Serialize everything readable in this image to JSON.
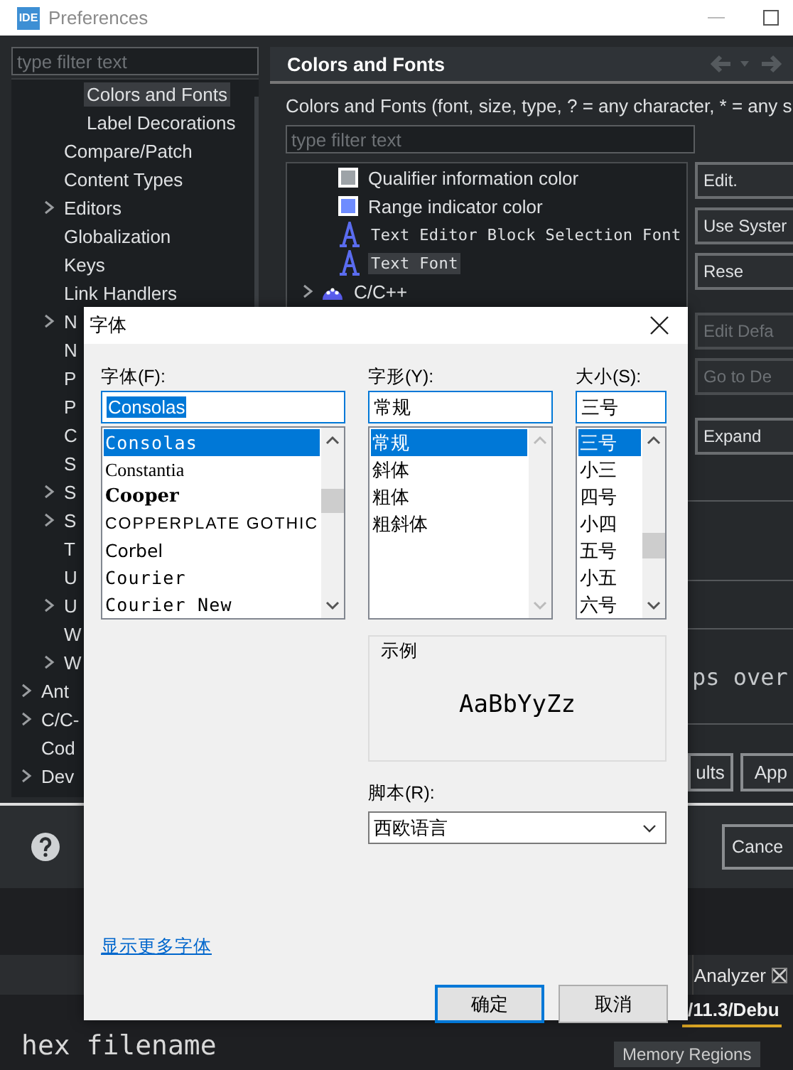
{
  "window": {
    "logo": "IDE",
    "title": "Preferences"
  },
  "sidebar": {
    "filter_placeholder": "type filter text",
    "items": [
      {
        "children": [
          {
            "children": [
              {
                "label": "Colors and Fonts",
                "has_children": false,
                "selected": true
              },
              {
                "label": "Label Decorations",
                "has_children": false,
                "selected": false
              }
            ]
          },
          {
            "label": "Compare/Patch",
            "has_children": false,
            "selected": false
          },
          {
            "label": "Content Types",
            "has_children": false,
            "selected": false
          },
          {
            "label": "Editors",
            "has_children": true,
            "selected": false
          },
          {
            "label": "Globalization",
            "has_children": false,
            "selected": false
          },
          {
            "label": "Keys",
            "has_children": false,
            "selected": false
          },
          {
            "label": "Link Handlers",
            "has_children": false,
            "selected": false
          },
          {
            "label": "N",
            "has_children": true,
            "selected": false
          },
          {
            "label": "N",
            "has_children": false,
            "selected": false
          },
          {
            "label": "P",
            "has_children": false,
            "selected": false
          },
          {
            "label": "P",
            "has_children": false,
            "selected": false
          },
          {
            "label": "C",
            "has_children": false,
            "selected": false
          },
          {
            "label": "S",
            "has_children": false,
            "selected": false
          },
          {
            "label": "S",
            "has_children": true,
            "selected": false
          },
          {
            "label": "S",
            "has_children": true,
            "selected": false
          },
          {
            "label": "T",
            "has_children": false,
            "selected": false
          },
          {
            "label": "U",
            "has_children": false,
            "selected": false
          },
          {
            "label": "U",
            "has_children": true,
            "selected": false
          },
          {
            "label": "W",
            "has_children": false,
            "selected": false
          },
          {
            "label": "W",
            "has_children": true,
            "selected": false
          }
        ]
      },
      {
        "label": "Ant",
        "has_children": true,
        "selected": false
      },
      {
        "label": "C/C-",
        "has_children": true,
        "selected": false
      },
      {
        "label": "Cod",
        "has_children": false,
        "selected": false
      },
      {
        "label": "Dev",
        "has_children": true,
        "selected": false
      }
    ]
  },
  "page": {
    "title": "Colors and Fonts",
    "description": "Colors and Fonts (font, size, type, ? = any character, * = any s",
    "filter_placeholder": "type filter text",
    "tree": [
      {
        "children": [
          {
            "children": [
              {
                "kind": "color",
                "label": "Qualifier information color",
                "color": "#9da3a8",
                "selected": false
              },
              {
                "kind": "color",
                "label": "Range indicator color",
                "color": "#6e8cff",
                "selected": false
              },
              {
                "kind": "font",
                "label": "Text Editor Block Selection Font",
                "selected": false
              },
              {
                "kind": "font",
                "label": "Text Font",
                "selected": true
              }
            ]
          }
        ]
      },
      {
        "kind": "category",
        "label": "C/C++",
        "selected": false
      }
    ],
    "buttons": [
      {
        "label": "Edit.",
        "disabled": false
      },
      {
        "label": "Use Syster",
        "disabled": false
      },
      {
        "label": "Rese",
        "disabled": false
      },
      {
        "label": "Edit Defa",
        "disabled": true
      },
      {
        "label": "Go to De",
        "disabled": true
      },
      {
        "label": "Expand",
        "disabled": false
      }
    ],
    "preview_text": "ps over",
    "footer_buttons": [
      "ults",
      "App"
    ],
    "cancel_button": "Cance"
  },
  "font_dialog": {
    "title": "字体",
    "font": {
      "label": "字体(F):",
      "value": "Consolas",
      "options": [
        {
          "label": "Consolas",
          "kind": "mono",
          "selected": true
        },
        {
          "label": "Constantia",
          "kind": "serif",
          "selected": false
        },
        {
          "label": "Cooper",
          "kind": "heavy",
          "selected": false
        },
        {
          "label": "COPPERPLATE GOTHIC",
          "kind": "wide",
          "selected": false
        },
        {
          "label": "Corbel",
          "kind": "sans",
          "selected": false
        },
        {
          "label": "Courier",
          "kind": "mono",
          "selected": false
        },
        {
          "label": "Courier New",
          "kind": "mono",
          "selected": false
        }
      ]
    },
    "style": {
      "label": "字形(Y):",
      "value": "常规",
      "options": [
        {
          "label": "常规",
          "selected": true
        },
        {
          "label": "斜体",
          "selected": false
        },
        {
          "label": "粗体",
          "selected": false
        },
        {
          "label": "粗斜体",
          "selected": false
        }
      ]
    },
    "size": {
      "label": "大小(S):",
      "value": "三号",
      "options": [
        {
          "label": "三号",
          "selected": true
        },
        {
          "label": "小三",
          "selected": false
        },
        {
          "label": "四号",
          "selected": false
        },
        {
          "label": "小四",
          "selected": false
        },
        {
          "label": "五号",
          "selected": false
        },
        {
          "label": "小五",
          "selected": false
        },
        {
          "label": "六号",
          "selected": false
        }
      ]
    },
    "sample": {
      "label": "示例",
      "text": "AaBbYyZz"
    },
    "script": {
      "label": "脚本(R):",
      "value": "西欧语言"
    },
    "more_fonts_link": "显示更多字体",
    "buttons": [
      {
        "label": "确定",
        "default": true
      },
      {
        "label": "取消",
        "default": false
      }
    ]
  },
  "ide": {
    "tabs": [
      {
        "label": "Analyzer"
      }
    ],
    "path": "/11.3/Debu",
    "bottom_tab": "Memory Regions",
    "editor_text": "hex filename"
  }
}
